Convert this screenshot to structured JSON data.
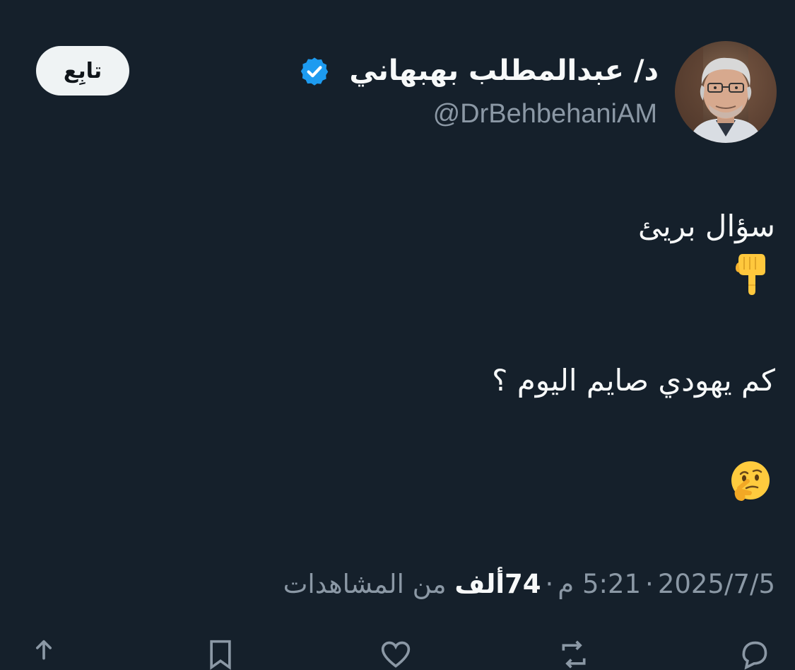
{
  "author": {
    "display_name": "د/ عبدالمطلب بهبهاني",
    "handle": "@DrBehbehaniAM",
    "verified": true,
    "avatar_icon": "profile-photo"
  },
  "follow_button": {
    "label": "تابِع"
  },
  "tweet": {
    "lines": [
      "سؤال بريئ",
      "👇",
      "كم يهودي صايم اليوم ؟",
      "🤔"
    ]
  },
  "meta": {
    "date": "2025/7/5",
    "time": "5:21 م",
    "views_count": "74ألف",
    "views_label": "من المشاهدات",
    "separator": "·"
  },
  "actions": {
    "icons": [
      "reply-icon",
      "retweet-icon",
      "like-icon",
      "bookmark-icon",
      "share-icon"
    ]
  },
  "colors": {
    "background": "#15202b",
    "text_primary": "#f7f9f9",
    "text_secondary": "#8b98a5",
    "verified": "#1d9bf0",
    "button_bg": "#eff3f4"
  }
}
